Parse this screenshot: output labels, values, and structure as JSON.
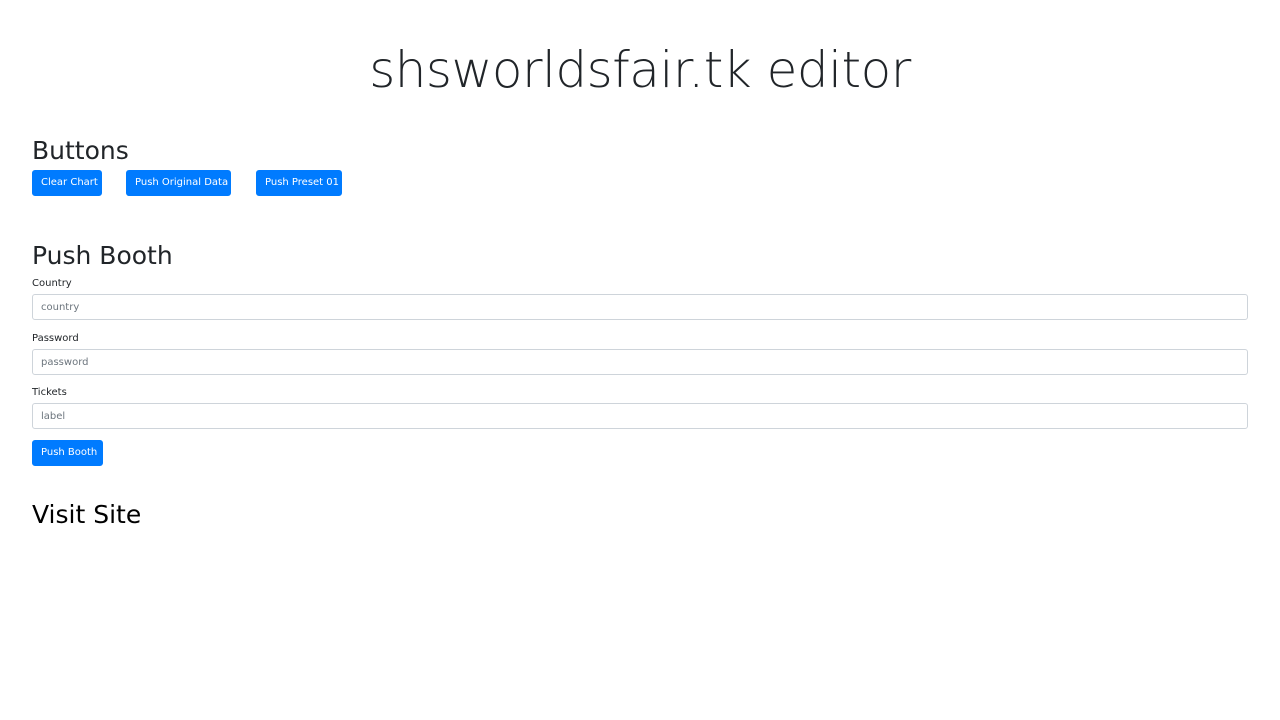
{
  "page": {
    "title": "shsworldsfair.tk editor"
  },
  "buttons_section": {
    "heading": "Buttons",
    "clear_chart_label": "Clear Chart",
    "push_original_data_label": "Push Original Data",
    "push_preset_label": "Push Preset 01"
  },
  "push_booth_section": {
    "heading": "Push Booth",
    "country": {
      "label": "Country",
      "placeholder": "country",
      "value": ""
    },
    "password": {
      "label": "Password",
      "placeholder": "password",
      "value": ""
    },
    "tickets": {
      "label": "Tickets",
      "placeholder": "label",
      "value": ""
    },
    "submit_label": "Push Booth"
  },
  "visit_site_section": {
    "heading": "Visit Site"
  },
  "colors": {
    "primary": "#007bff",
    "text": "#212529",
    "input_border": "#ced4da"
  }
}
